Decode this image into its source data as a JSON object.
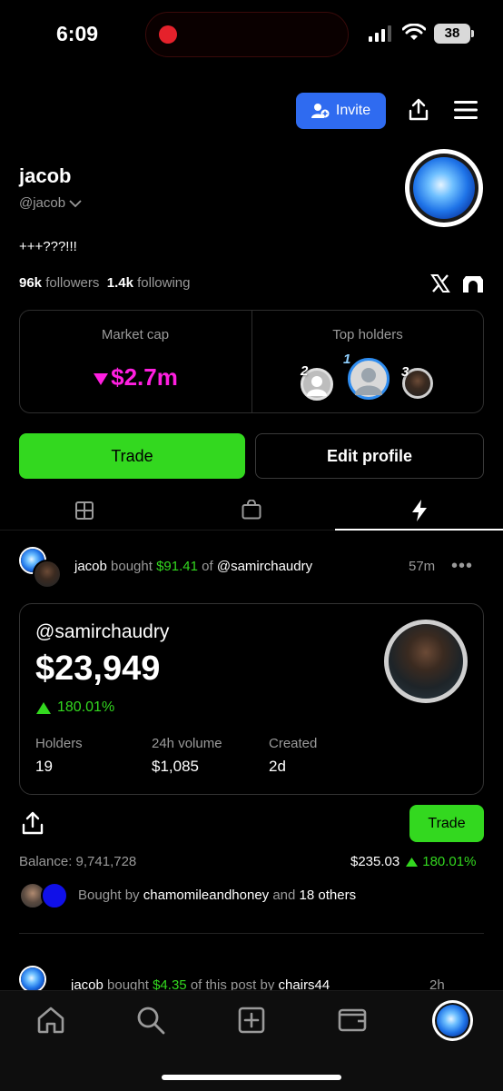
{
  "status_bar": {
    "time": "6:09",
    "battery": "38"
  },
  "header": {
    "invite_label": "Invite"
  },
  "profile": {
    "name": "jacob",
    "handle": "@jacob",
    "bio": "+++???!!!",
    "followers_count": "96k",
    "followers_label": "followers",
    "following_count": "1.4k",
    "following_label": "following"
  },
  "stats": {
    "market_cap_label": "Market cap",
    "market_cap_value": "$2.7m",
    "top_holders_label": "Top holders",
    "holder_ranks": [
      "1",
      "2",
      "3"
    ]
  },
  "actions": {
    "trade_label": "Trade",
    "edit_label": "Edit profile"
  },
  "tabs": [
    "grid",
    "shopping-bag",
    "activity"
  ],
  "feed": [
    {
      "user": "jacob",
      "verb": "bought",
      "amount": "$91.41",
      "of": "of",
      "target": "@samirchaudry",
      "time": "57m",
      "coin": {
        "handle": "@samirchaudry",
        "price": "$23,949",
        "change": "180.01%",
        "holders_label": "Holders",
        "holders": "19",
        "volume_label": "24h volume",
        "volume": "$1,085",
        "created_label": "Created",
        "created": "2d"
      },
      "trade_label": "Trade",
      "balance_label": "Balance:",
      "balance": "9,741,728",
      "value": "$235.03",
      "value_change": "180.01%",
      "bought_by_prefix": "Bought by",
      "bought_by_user": "chamomileandhoney",
      "bought_by_and": "and",
      "bought_by_others": "18 others"
    },
    {
      "user": "jacob",
      "verb": "bought",
      "amount": "$4.35",
      "rest": "of this post by",
      "target": "chairs44",
      "time": "2h"
    }
  ],
  "colors": {
    "accent_green": "#33d81f",
    "magenta": "#ff1fe0",
    "invite_blue": "#2f6bf0"
  }
}
